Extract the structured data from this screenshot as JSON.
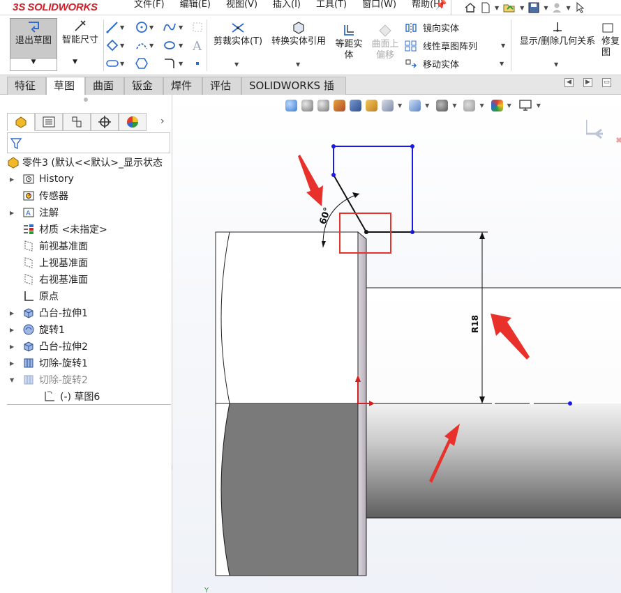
{
  "app": {
    "logo_ds": "3S",
    "logo_text": "SOLIDWORKS"
  },
  "menu": {
    "items": [
      "文件(F)",
      "编辑(E)",
      "视图(V)",
      "插入(I)",
      "工具(T)",
      "窗口(W)",
      "帮助(H)"
    ]
  },
  "commands": {
    "exit_sketch": "退出草图",
    "smart_dimension": "智能尺寸",
    "trim_entities": "剪裁实体(T)",
    "convert_entities": "转换实体引用",
    "offset_entities_1": "等距实",
    "offset_entities_2": "体",
    "offset_surface_1": "曲面上",
    "offset_surface_2": "偏移",
    "mirror_entities": "镜向实体",
    "linear_pattern": "线性草图阵列",
    "move_entities": "移动实体",
    "display_relations": "显示/删除几何关系",
    "repair_1": "修复",
    "repair_2": "图"
  },
  "tabs": [
    "特征",
    "草图",
    "曲面",
    "钣金",
    "焊件",
    "评估",
    "SOLIDWORKS 插件"
  ],
  "active_tab": "草图",
  "tree": {
    "root": "零件3  (默认<<默认>_显示状态",
    "items": [
      {
        "label": "History",
        "icon": "history-icon"
      },
      {
        "label": "传感器",
        "icon": "sensor-icon"
      },
      {
        "label": "注解",
        "icon": "annotation-icon"
      },
      {
        "label": "材质 <未指定>",
        "icon": "material-icon"
      },
      {
        "label": "前视基准面",
        "icon": "plane-icon"
      },
      {
        "label": "上视基准面",
        "icon": "plane-icon"
      },
      {
        "label": "右视基准面",
        "icon": "plane-icon"
      },
      {
        "label": "原点",
        "icon": "origin-icon"
      },
      {
        "label": "凸台-拉伸1",
        "icon": "extrude-icon"
      },
      {
        "label": "旋转1",
        "icon": "revolve-icon"
      },
      {
        "label": "凸台-拉伸2",
        "icon": "extrude-icon"
      },
      {
        "label": "切除-旋转1",
        "icon": "cut-revolve-icon"
      },
      {
        "label": "切除-旋转2",
        "icon": "cut-revolve-icon"
      },
      {
        "label": "(-) 草图6",
        "icon": "sketch-icon"
      }
    ]
  },
  "sketch": {
    "angle_dimension": "60°",
    "radius_dimension": "R18"
  },
  "colors": {
    "accent": "#1d6fd2",
    "brand_red": "#d0202a",
    "sketch_blue": "#1a1ae6",
    "annotation_red": "#e8312a"
  }
}
